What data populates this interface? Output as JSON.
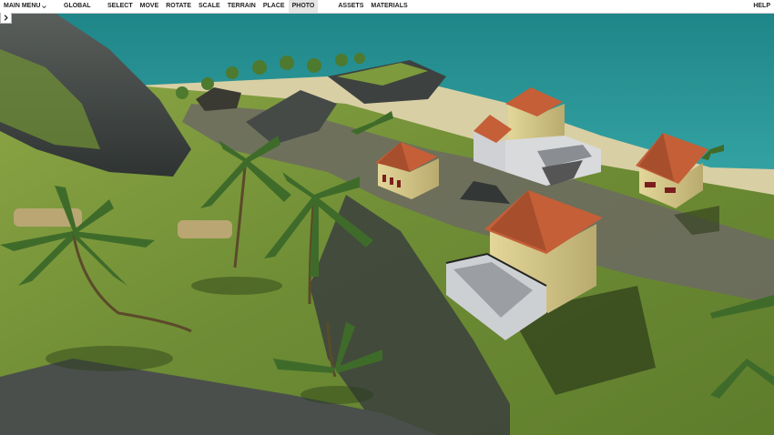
{
  "toolbar": {
    "main_menu": "MAIN MENU",
    "items": [
      "GLOBAL",
      "SELECT",
      "MOVE",
      "ROTATE",
      "SCALE",
      "TERRAIN",
      "PLACE",
      "PHOTO",
      "ASSETS",
      "MATERIALS"
    ],
    "active": "PHOTO",
    "help": "HELP"
  },
  "icons": {
    "main_menu_caret": "chevron-down-icon",
    "panel_toggle": "chevron-right-icon"
  },
  "scene": {
    "sea_color": "#2d9a98",
    "grass_color": "#7a9a3a",
    "rock_color": "#4a4f4d",
    "roof_color": "#c45f38",
    "wall_color": "#d7c98c"
  }
}
